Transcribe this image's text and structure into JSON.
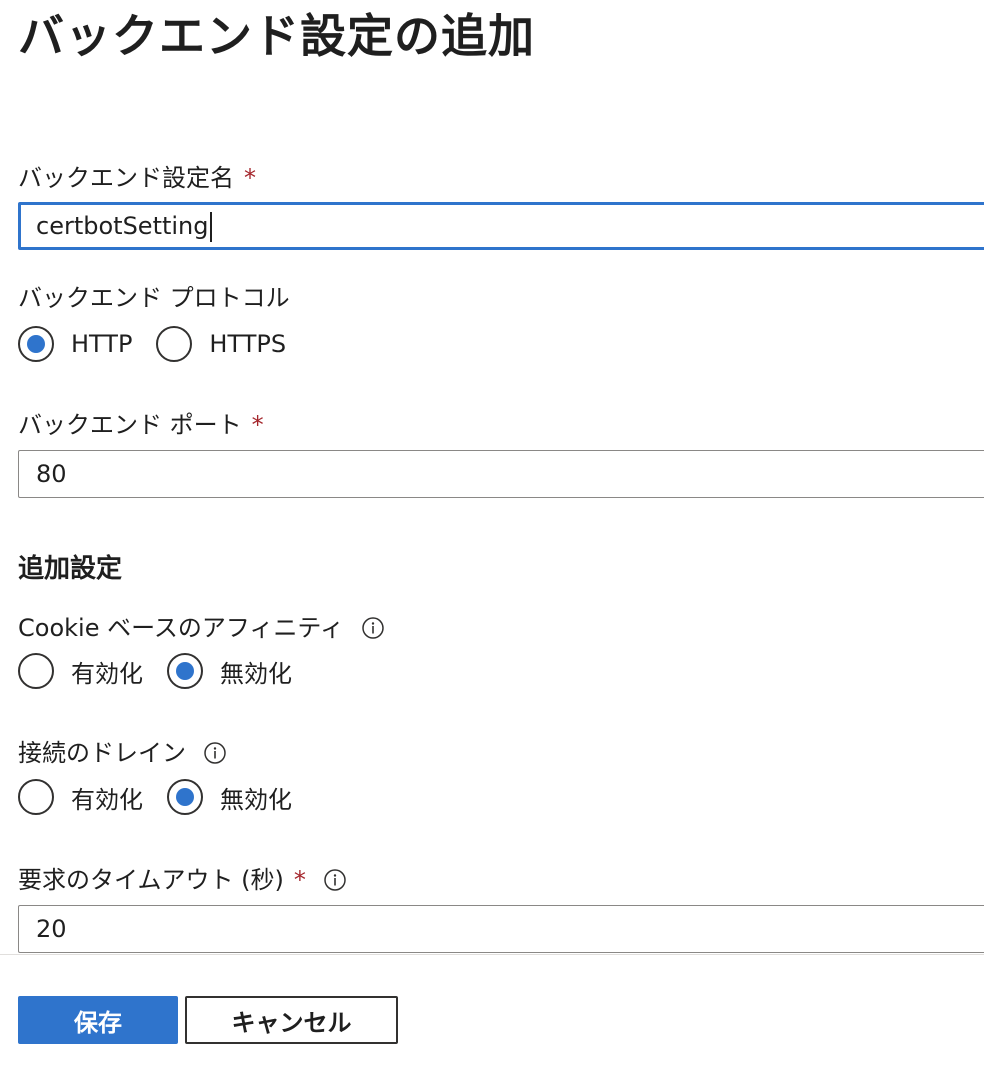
{
  "page": {
    "title": "バックエンド設定の追加"
  },
  "fields": {
    "name": {
      "label": "バックエンド設定名",
      "required_mark": "*",
      "value": "certbotSetting"
    },
    "protocol": {
      "label": "バックエンド プロトコル",
      "options": [
        "HTTP",
        "HTTPS"
      ],
      "selected": "HTTP"
    },
    "port": {
      "label": "バックエンド ポート",
      "required_mark": "*",
      "value": "80"
    }
  },
  "additional": {
    "heading": "追加設定",
    "cookie_affinity": {
      "label": "Cookie ベースのアフィニティ",
      "options": [
        "有効化",
        "無効化"
      ],
      "selected": "無効化"
    },
    "connection_draining": {
      "label": "接続のドレイン",
      "options": [
        "有効化",
        "無効化"
      ],
      "selected": "無効化"
    },
    "request_timeout": {
      "label": "要求のタイムアウト (秒)",
      "required_mark": "*",
      "value": "20"
    }
  },
  "footer": {
    "save_label": "保存",
    "cancel_label": "キャンセル"
  },
  "colors": {
    "accent": "#2f74cc",
    "required": "#a4262c",
    "border": "#8a8886"
  },
  "icons": {
    "info": "info-icon"
  }
}
